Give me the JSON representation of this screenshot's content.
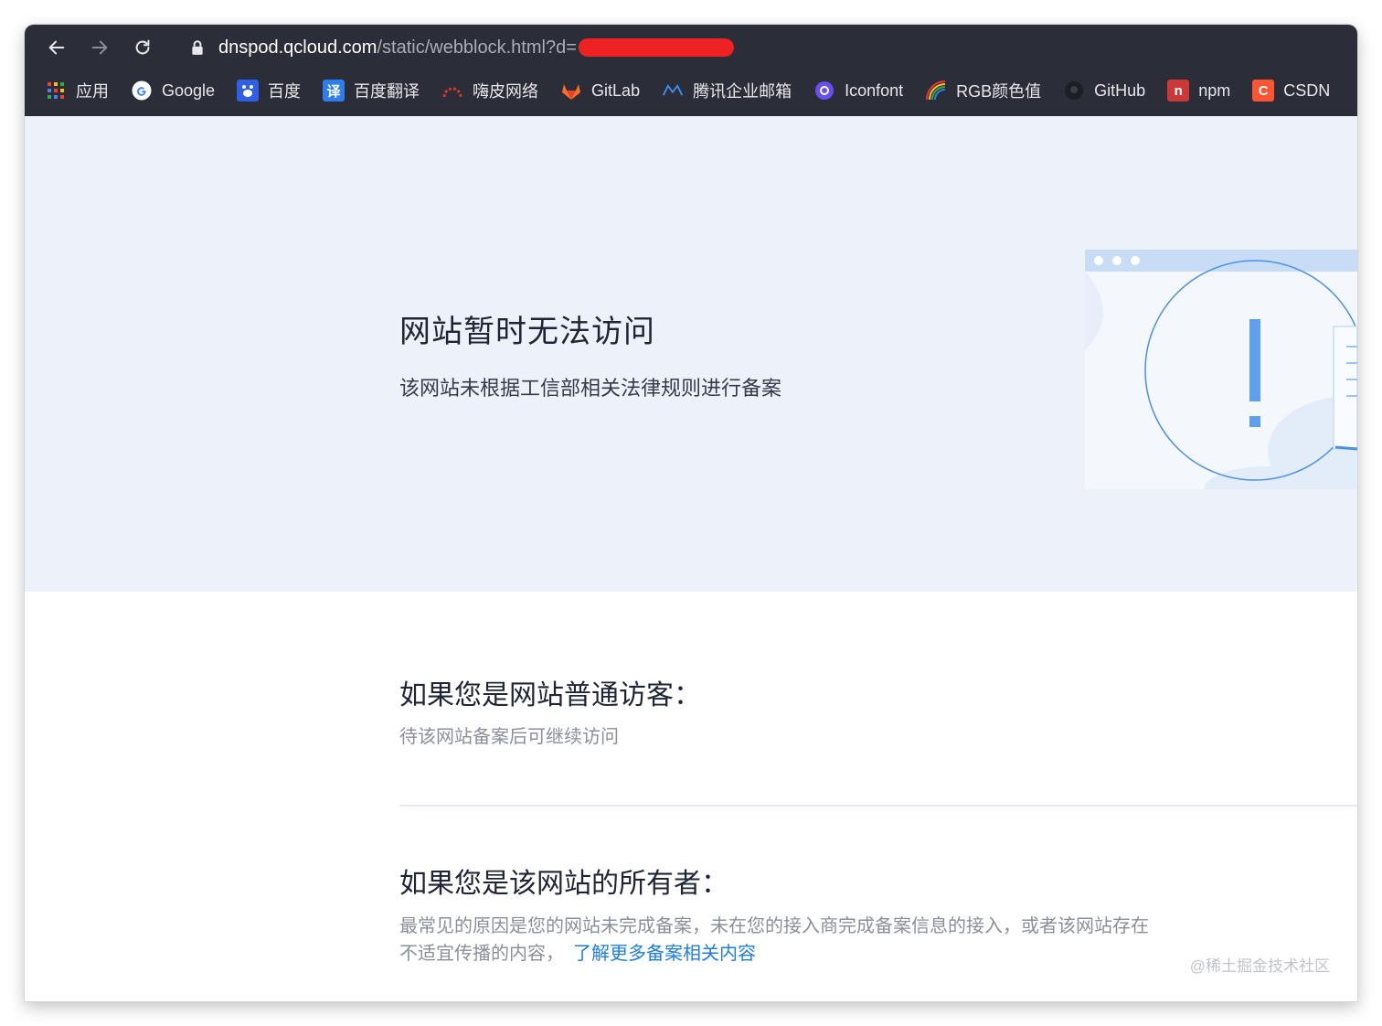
{
  "browser": {
    "url_host": "dnspod.qcloud.com",
    "url_path": "/static/webblock.html?d=",
    "bookmarks": [
      {
        "label": "应用",
        "icon": "apps-grid-icon"
      },
      {
        "label": "Google",
        "icon": "google-icon",
        "color": "#4285f4"
      },
      {
        "label": "百度",
        "icon": "baidu-icon",
        "color": "#2f5fe8"
      },
      {
        "label": "百度翻译",
        "icon": "baidu-translate-icon",
        "glyph": "译",
        "color": "#2c7df0"
      },
      {
        "label": "嗨皮网络",
        "icon": "haipi-icon",
        "color": "#d9342b"
      },
      {
        "label": "GitLab",
        "icon": "gitlab-icon",
        "color": "#fc6d26"
      },
      {
        "label": "腾讯企业邮箱",
        "icon": "tencent-mail-icon",
        "color": "#3c8ef5"
      },
      {
        "label": "Iconfont",
        "icon": "iconfont-icon",
        "color": "#6b4ef2"
      },
      {
        "label": "RGB颜色值",
        "icon": "rainbow-icon"
      },
      {
        "label": "GitHub",
        "icon": "github-icon",
        "color": "#1b1f23"
      },
      {
        "label": "npm",
        "icon": "npm-icon",
        "glyph": "n",
        "color": "#cb3837"
      },
      {
        "label": "CSDN",
        "icon": "csdn-icon",
        "glyph": "C",
        "color": "#fc5531"
      }
    ]
  },
  "hero": {
    "title": "网站暂时无法访问",
    "subtitle": "该网站未根据工信部相关法律规则进行备案"
  },
  "visitor": {
    "title": "如果您是网站普通访客：",
    "text": "待该网站备案后可继续访问"
  },
  "owner": {
    "title": "如果您是该网站的所有者：",
    "text_line1": "最常见的原因是您的网站未完成备案，未在您的接入商完成备案信息的接入，或者该网站存在",
    "text_line2": "不适宜传播的内容，",
    "link": "了解更多备案相关内容"
  },
  "watermark": "@稀土掘金技术社区",
  "colors": {
    "chrome": "#2b2e38",
    "hero_bg": "#ecf1fa",
    "accent": "#4a8fe8",
    "link": "#1f7fe0"
  }
}
